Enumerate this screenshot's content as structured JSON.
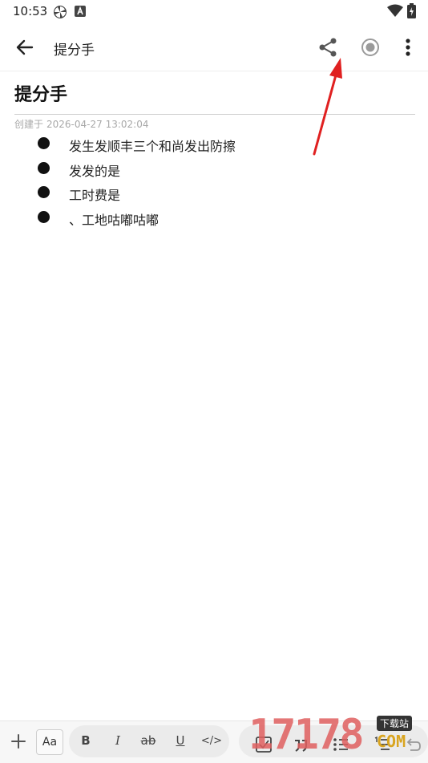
{
  "status_bar": {
    "time": "10:53",
    "icons": [
      "pinwheel-icon",
      "a-badge-icon",
      "wifi-icon",
      "battery-charging-icon"
    ]
  },
  "app_bar": {
    "title": "提分手",
    "actions": [
      "back-arrow-icon",
      "share-icon",
      "record-icon",
      "more-vert-icon"
    ]
  },
  "note": {
    "title": "提分手",
    "meta_label": "创建于",
    "created_at": "2026-04-27 13:02:04",
    "bullets": [
      "发生发顺丰三个和尚发出防擦",
      "发发的是",
      "工时费是",
      "、工地咕嘟咕嘟"
    ]
  },
  "toolbar": {
    "aa_label": "Aa",
    "bold_label": "B",
    "italic_label": "I",
    "strike_label": "ab",
    "underline_label": "U",
    "code_label": "</>"
  },
  "watermark": {
    "number": "17178",
    "badge": "下载站",
    "suffix": "COM"
  },
  "colors": {
    "annotation_arrow": "#e02020",
    "bullet": "#111111",
    "meta_text": "#a8a8a8"
  }
}
